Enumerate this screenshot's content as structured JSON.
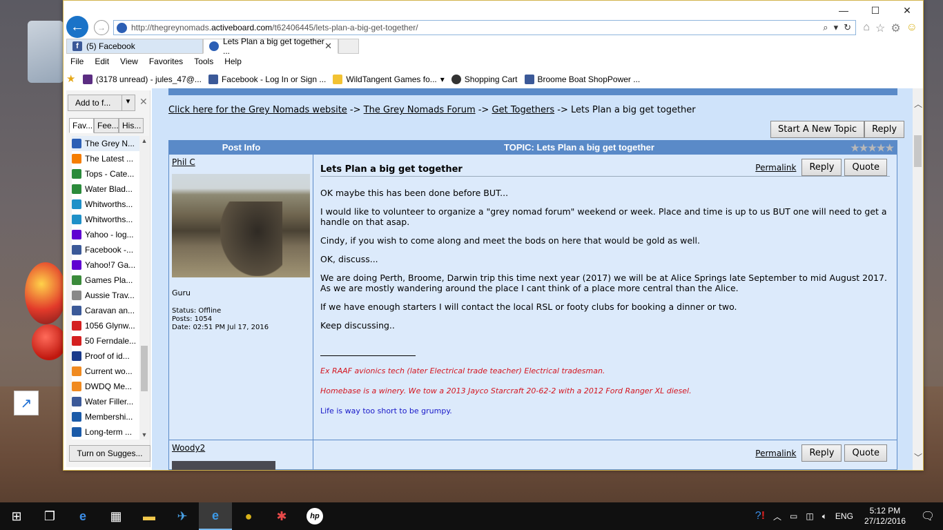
{
  "browser": {
    "url_prefix": "http://thegreynomads.",
    "url_domain": "activeboard.com",
    "url_path": "/t62406445/lets-plan-a-big-get-together/",
    "tabs": [
      {
        "label": "(5) Facebook"
      },
      {
        "label": "Lets Plan a big get together ..."
      }
    ],
    "menu": [
      "File",
      "Edit",
      "View",
      "Favorites",
      "Tools",
      "Help"
    ],
    "favorites_bar": [
      {
        "label": "(3178 unread) - jules_47@...",
        "icon": "mail-icon"
      },
      {
        "label": "Facebook - Log In or Sign ...",
        "icon": "facebook-icon"
      },
      {
        "label": "WildTangent Games fo...",
        "icon": "wildtangent-icon"
      },
      {
        "label": "Shopping Cart",
        "icon": "cart-icon"
      },
      {
        "label": "Broome Boat ShopPower ...",
        "icon": "facebook-icon"
      }
    ]
  },
  "fav_panel": {
    "add_label": "Add to f...",
    "tabs": [
      "Fav...",
      "Fee...",
      "His..."
    ],
    "items": [
      {
        "label": "The Grey N...",
        "color": "#2c5fb5"
      },
      {
        "label": "The Latest ...",
        "color": "#f57d00"
      },
      {
        "label": "Tops - Cate...",
        "color": "#2a8a3a"
      },
      {
        "label": "Water Blad...",
        "color": "#2a8a3a"
      },
      {
        "label": "Whitworths...",
        "color": "#1e90c8"
      },
      {
        "label": "Whitworths...",
        "color": "#1e90c8"
      },
      {
        "label": "Yahoo - log...",
        "color": "#5f01d1"
      },
      {
        "label": "Facebook -...",
        "color": "#3b5998"
      },
      {
        "label": "Yahoo!7 Ga...",
        "color": "#5f01d1"
      },
      {
        "label": "Games  Pla...",
        "color": "#3a8a3a"
      },
      {
        "label": "Aussie Trav...",
        "color": "#888888"
      },
      {
        "label": "Caravan an...",
        "color": "#3b5998"
      },
      {
        "label": "1056 Glynw...",
        "color": "#d42020"
      },
      {
        "label": "50 Ferndale...",
        "color": "#d42020"
      },
      {
        "label": "Proof of id...",
        "color": "#1a3a8a"
      },
      {
        "label": "Current wo...",
        "color": "#f08a20"
      },
      {
        "label": "DWDQ Me...",
        "color": "#f08a20"
      },
      {
        "label": "Water Filler...",
        "color": "#3b5998"
      },
      {
        "label": "Membershi...",
        "color": "#1a5aa8"
      },
      {
        "label": "Long-term ...",
        "color": "#1a5aa8"
      }
    ],
    "suggest_label": "Turn on Sugges..."
  },
  "page": {
    "breadcrumb": {
      "site_link": "Click here for the Grey Nomads website",
      "sep": " -> ",
      "forum_link": "The Grey Nomads Forum",
      "section_link": "Get Togethers",
      "current": "Lets Plan a big get together"
    },
    "start_topic": "Start A New Topic",
    "reply": "Reply",
    "table_head": {
      "post_info": "Post Info",
      "topic": "TOPIC: Lets Plan a big get together",
      "stars": "★★★★★"
    },
    "post1": {
      "username": "Phil C",
      "rank": "Guru",
      "status": "Status: Offline",
      "posts": "Posts: 1054",
      "date": "Date: 02:51 PM Jul 17, 2016",
      "title": "Lets Plan a big get together",
      "permalink": "Permalink",
      "reply": "Reply",
      "quote": "Quote",
      "paragraphs": [
        "OK maybe this has been done before BUT...",
        "I would like to volunteer to organize a \"grey nomad forum\" weekend or week. Place and time is up to us BUT one will need to get a handle on that asap.",
        "Cindy, if you wish to come along and meet the bods on here that would be gold as well.",
        "OK, discuss...",
        "We are doing Perth, Broome, Darwin trip this time next year (2017) we will be at Alice Springs late September to mid August 2017. As we are mostly wandering around the place I cant think of a place more central than the Alice.",
        "If we have enough starters I will contact the local RSL or footy clubs for booking a dinner or two.",
        "Keep discussing.."
      ],
      "sig1": "Ex RAAF avionics tech (later Electrical trade teacher) Electrical tradesman.",
      "sig2": "Homebase is a winery. We tow a 2013 Jayco Starcraft 20-62-2 with a 2012 Ford Ranger  XL diesel.",
      "sig3": "Life is way too short to be grumpy."
    },
    "post2": {
      "username": "Woody2",
      "permalink": "Permalink",
      "reply": "Reply",
      "quote": "Quote"
    }
  },
  "taskbar": {
    "language": "ENG",
    "time": "5:12 PM",
    "date": "27/12/2016"
  }
}
